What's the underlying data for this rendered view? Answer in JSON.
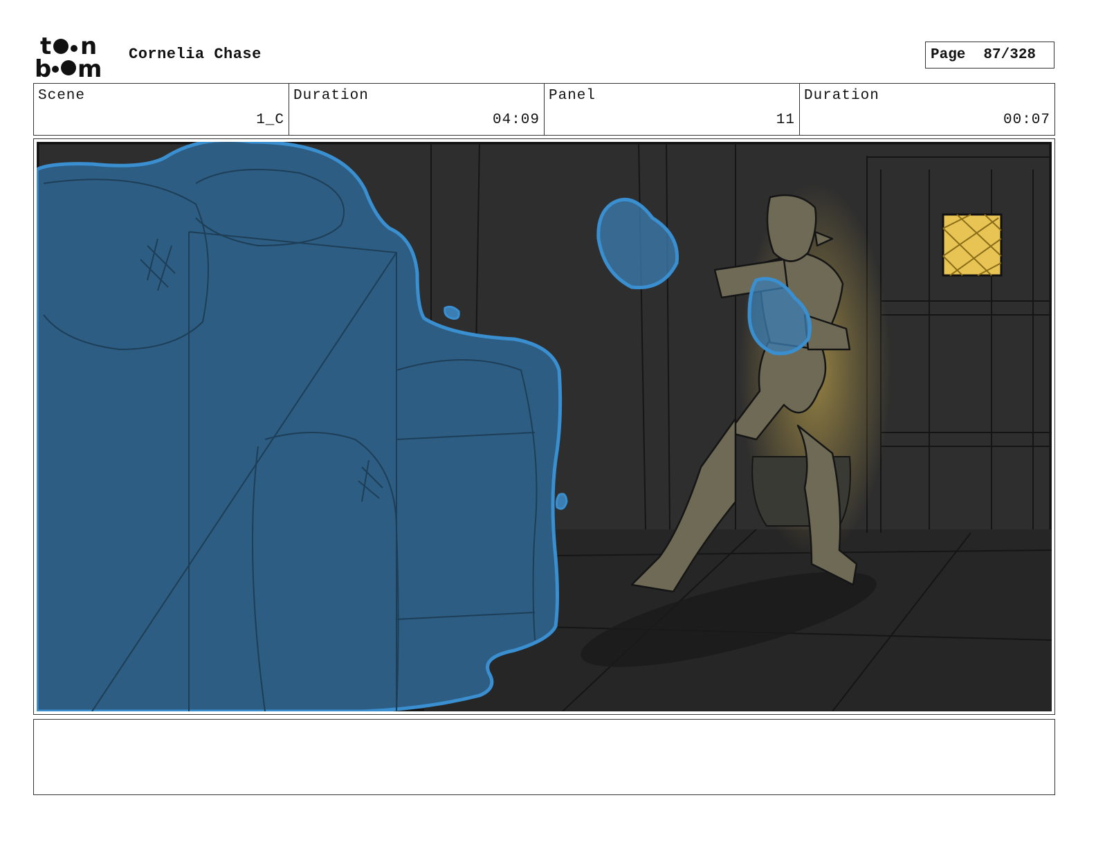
{
  "header": {
    "logo_text_top": "toon",
    "logo_text_bottom": "boom",
    "title": "Cornelia Chase",
    "page_label": "Page",
    "page_value": "87/328"
  },
  "info": {
    "scene_label": "Scene",
    "scene_value": "1_C",
    "duration_label": "Duration",
    "duration_value": "04:09",
    "panel_label": "Panel",
    "panel_value": "11",
    "panel_duration_label": "Duration",
    "panel_duration_value": "00:07"
  },
  "notes": {
    "text": ""
  },
  "colors": {
    "background": "#2e2e2e",
    "water": "#2d5d82",
    "water_outline": "#3a8fd0",
    "character": "#6e6a56",
    "window_light": "#e7c454"
  }
}
